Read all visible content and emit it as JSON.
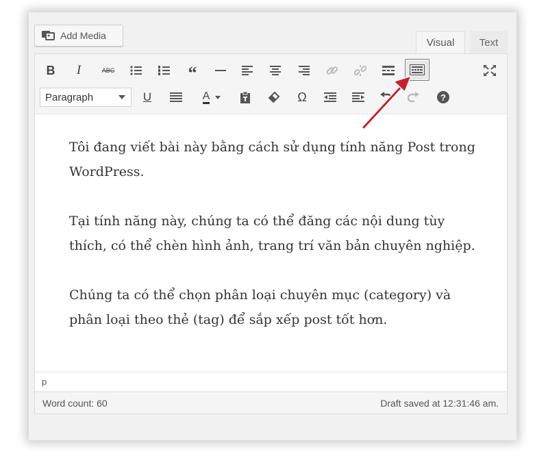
{
  "add_media": {
    "label": "Add Media",
    "icon": "media-icon"
  },
  "tabs": [
    {
      "label": "Visual",
      "active": true
    },
    {
      "label": "Text",
      "active": false
    }
  ],
  "toolbar": {
    "row1": [
      "bold",
      "italic",
      "strikethrough",
      "bullet-list",
      "numbered-list",
      "blockquote",
      "horizontal-line",
      "align-left",
      "align-center",
      "align-right",
      "insert-link",
      "remove-link",
      "read-more",
      "toolbar-toggle",
      "fullscreen"
    ],
    "row2": [
      "format-select",
      "underline",
      "justify",
      "text-color",
      "paste-as-text",
      "clear-formatting",
      "special-character",
      "decrease-indent",
      "increase-indent",
      "undo",
      "redo",
      "help"
    ],
    "bold_label": "B",
    "italic_label": "I",
    "strike_label": "ABC",
    "underline_label": "U",
    "color_label": "A",
    "omega_label": "Ω",
    "help_label": "?"
  },
  "format_select": {
    "value": "Paragraph"
  },
  "content": {
    "paragraphs": [
      "Tôi đang viết bài này bằng cách sử dụng tính năng Post trong WordPress.",
      "Tại tính năng này, chúng ta có thể đăng các nội dung tùy thích, có thể chèn hình ảnh, trang trí văn bản chuyên nghiệp.",
      "Chúng ta có thể chọn phân loại chuyên mục (category) và phân loại theo thẻ (tag) để sắp xếp post tốt hơn."
    ]
  },
  "path": "p",
  "status": {
    "word_count": "Word count: 60",
    "draft_saved": "Draft saved at 12:31:46 am."
  },
  "colors": {
    "annotation_arrow": "#c8202a",
    "frame": "#f5f5f5",
    "text": "#333333"
  }
}
